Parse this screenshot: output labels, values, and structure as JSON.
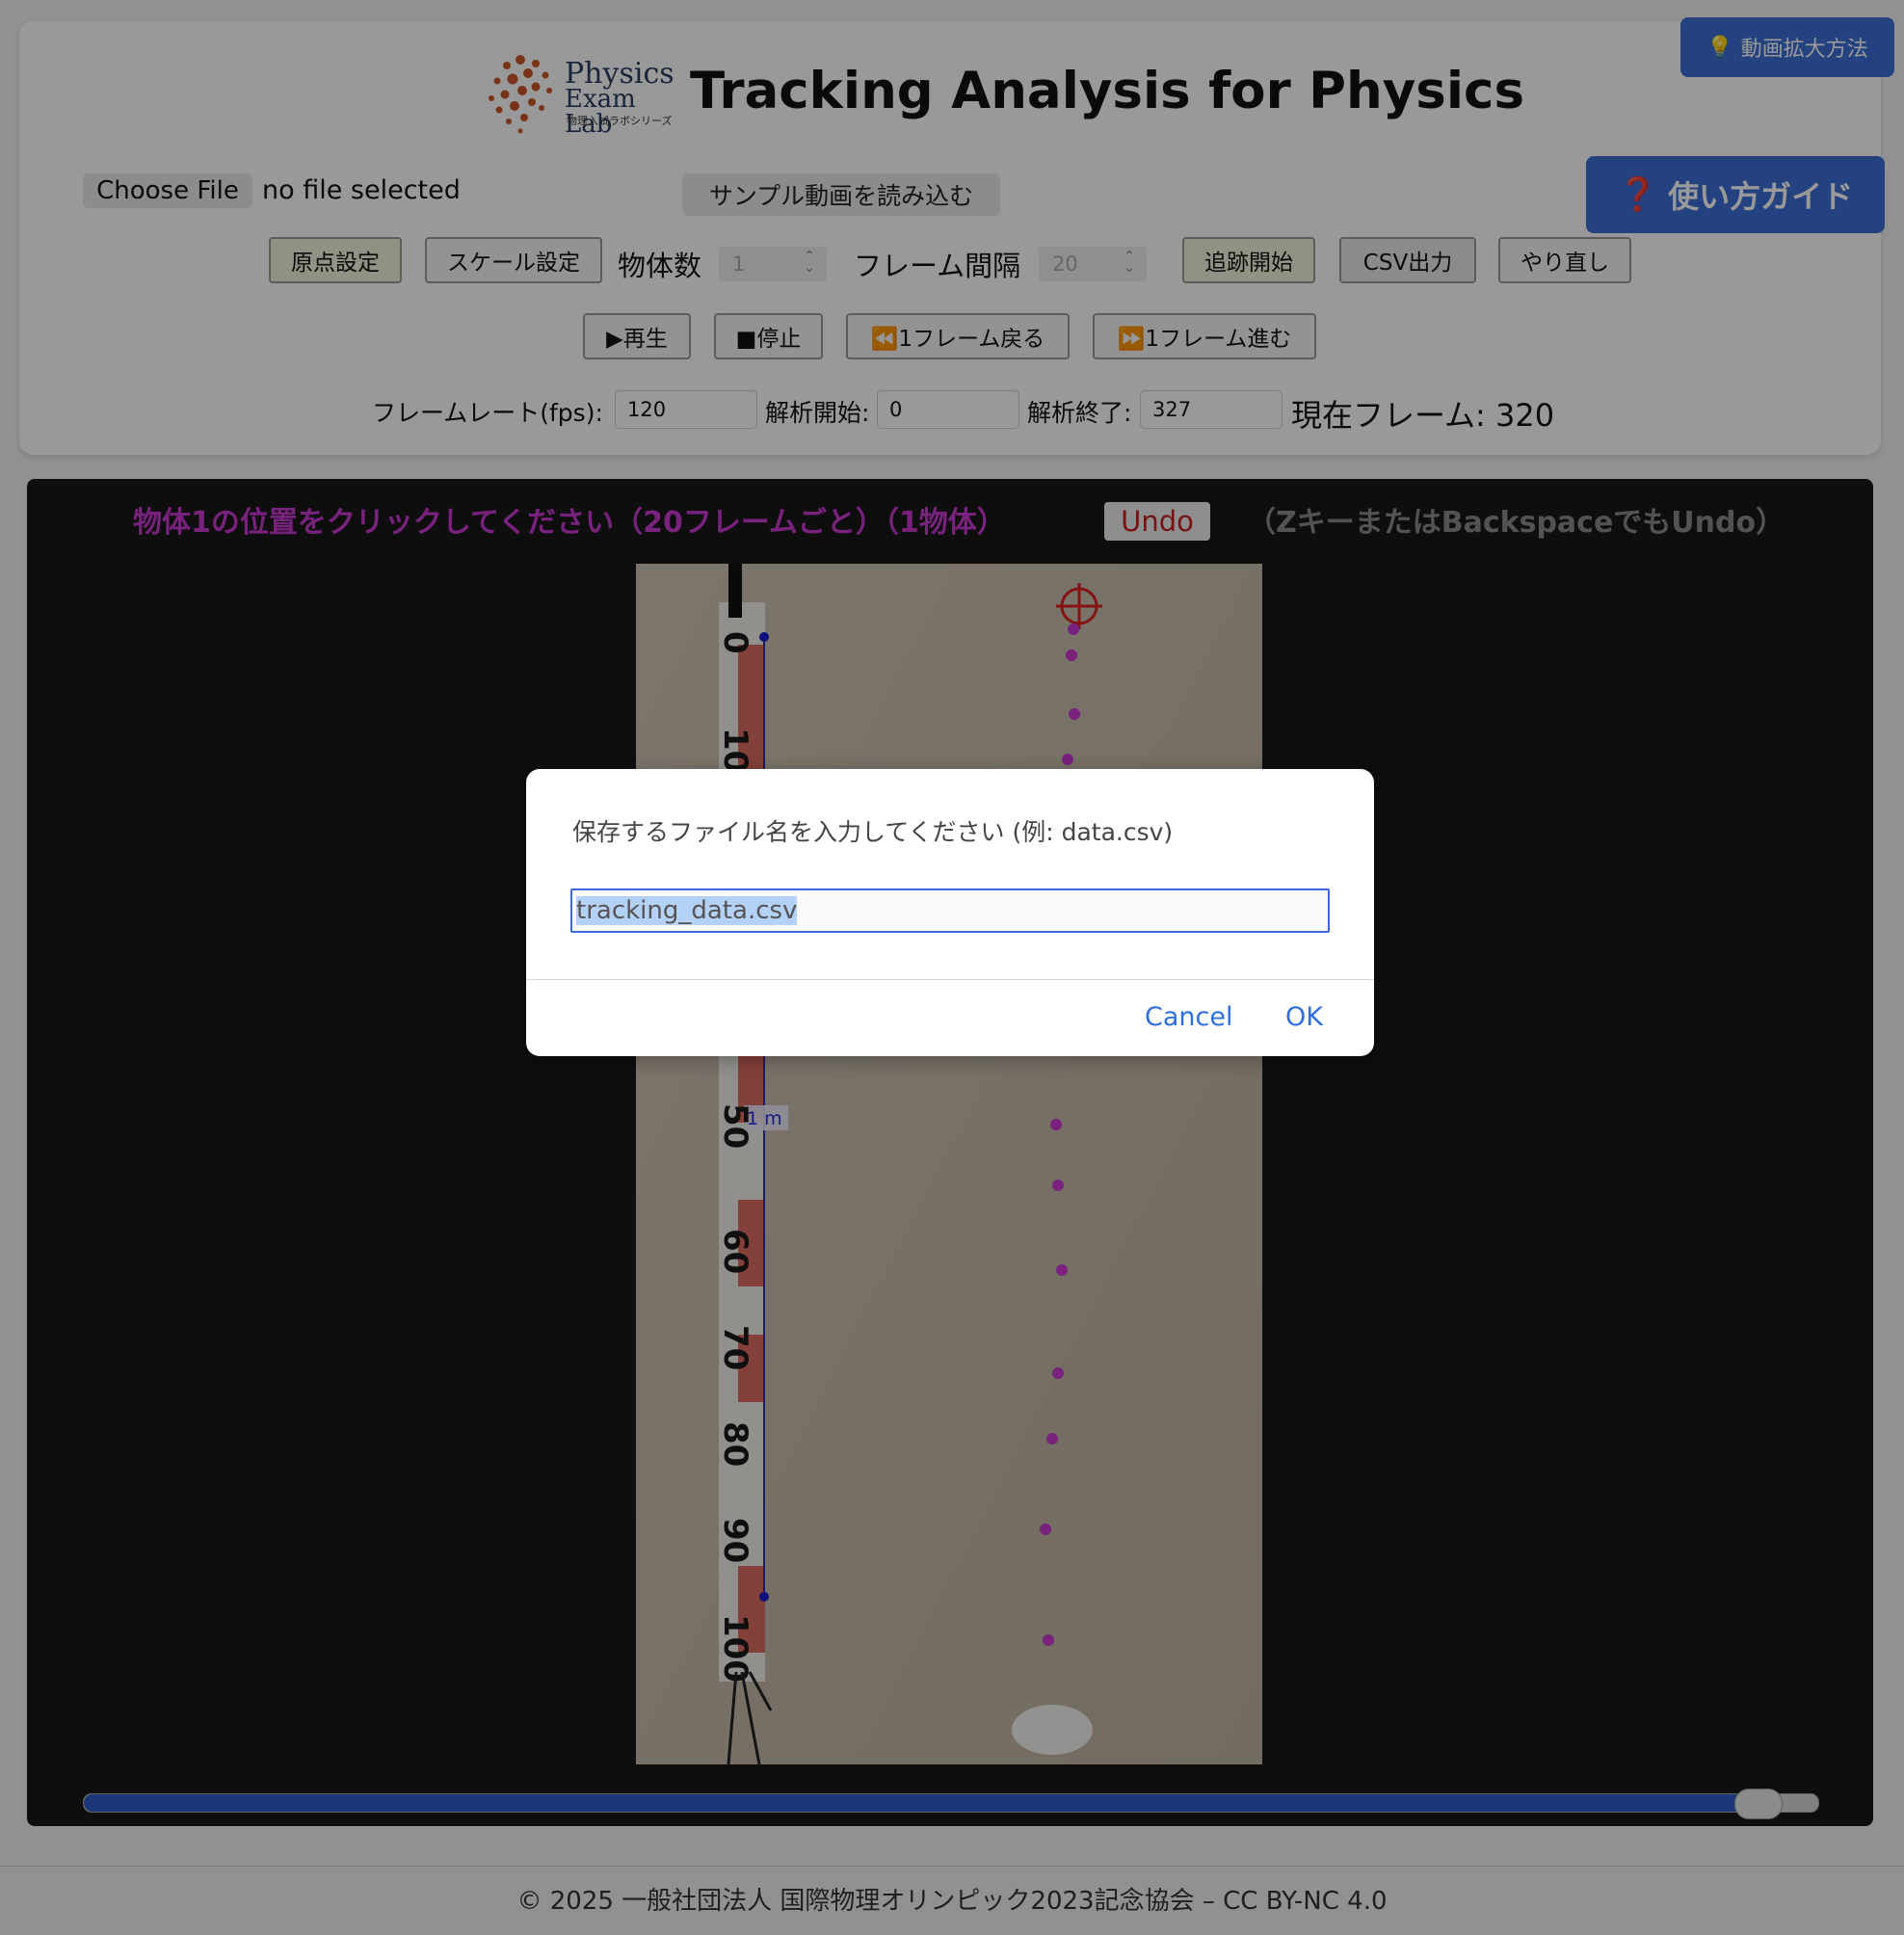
{
  "header": {
    "logo_line1": "Physics",
    "logo_line2": "Exam Lab",
    "logo_line3": "物理入試ラボシリーズ",
    "title": "Tracking Analysis for Physics",
    "corner_button": "動画拡大方法",
    "guide_button": "使い方ガイド"
  },
  "file": {
    "choose_label": "Choose File",
    "status": "no file selected",
    "sample_button": "サンプル動画を読み込む"
  },
  "toolbar": {
    "origin": "原点設定",
    "scale": "スケール設定",
    "objects_label": "物体数",
    "objects_value": "1",
    "interval_label": "フレーム間隔",
    "interval_value": "20",
    "start_tracking": "追跡開始",
    "csv_output": "CSV出力",
    "redo": "やり直し"
  },
  "playback": {
    "play": "▶再生",
    "stop": "■停止",
    "back": "⏪1フレーム戻る",
    "forward": "⏩1フレーム進む"
  },
  "params": {
    "fps_label": "フレームレート(fps):",
    "fps_value": "120",
    "start_label": "解析開始:",
    "start_value": "0",
    "end_label": "解析終了:",
    "end_value": "327",
    "current_label": "現在フレーム: 320"
  },
  "stage": {
    "instruction": "物体1の位置をクリックしてください（20フレームごと）（1物体）",
    "undo": "Undo",
    "hint": "（ZキーまたはBackspaceでもUndo）",
    "scale_label": "1 m",
    "ruler_marks": [
      "0",
      "10",
      "50",
      "60",
      "70",
      "80",
      "90",
      "100"
    ],
    "slider_position": 0.965
  },
  "dialog": {
    "message": "保存するファイル名を入力してください (例: data.csv)",
    "input_value": "tracking_data.csv",
    "cancel": "Cancel",
    "ok": "OK"
  },
  "footer": {
    "text": "© 2025 一般社団法人 国際物理オリンピック2023記念協会 – CC BY-NC 4.0"
  },
  "colors": {
    "accent": "#3b6fd4",
    "track_points": "#c83ad1",
    "instruction": "#c83ad1",
    "undo_text": "#c62020",
    "crosshair": "#e02020"
  }
}
